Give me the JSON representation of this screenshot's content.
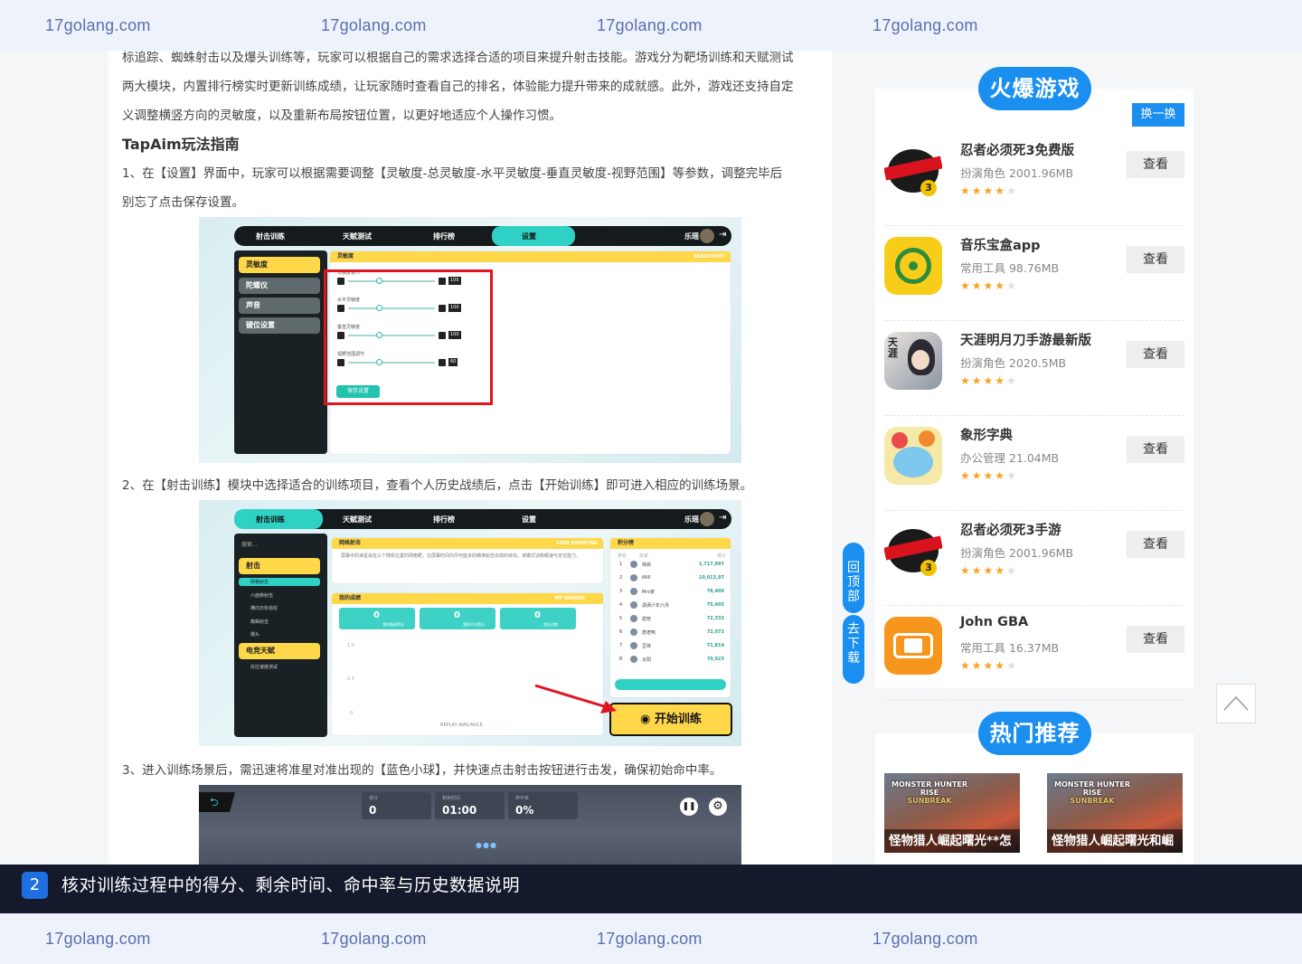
{
  "watermark": {
    "text": "17golang.com"
  },
  "article": {
    "intro_lines": [
      "标追踪、蜘蛛射击以及爆头训练等，玩家可以根据自己的需求选择合适的项目来提升射击技能。游戏分为靶场训练和天赋测试",
      "两大模块，内置排行榜实时更新训练成绩，让玩家随时查看自己的排名，体验能力提升带来的成就感。此外，游戏还支持自定",
      "义调整横竖方向的灵敏度，以及重新布局按钮位置，以更好地适应个人操作习惯。"
    ],
    "guide_title": "TapAim玩法指南",
    "step1_lines": [
      "1、在【设置】界面中，玩家可以根据需要调整【灵敏度-总灵敏度-水平灵敏度-垂直灵敏度-视野范围】等参数，调整完毕后",
      "别忘了点击保存设置。"
    ],
    "step2": "2、在【射击训练】模块中选择适合的训练项目，查看个人历史战绩后，点击【开始训练】即可进入相应的训练场景。",
    "step3": "3、进入训练场景后，需迅速将准星对准出现的【蓝色小球】，并快速点击射击按钮进行击发，确保初始命中率。"
  },
  "shot1": {
    "nav": [
      "射击训练",
      "天赋测试",
      "排行榜",
      "设置"
    ],
    "nav_user": "乐瑶",
    "side": [
      "灵敏度",
      "陀螺仪",
      "声音",
      "键位设置"
    ],
    "panel_title": "灵敏度",
    "panel_tag": "SENSITIVITY",
    "rows": [
      {
        "label": "灵敏度调节",
        "value": "100",
        "level": 0.35
      },
      {
        "label": "水平灵敏度",
        "value": "100",
        "level": 0.35
      },
      {
        "label": "垂直灵敏度",
        "value": "100",
        "level": 0.35
      },
      {
        "label": "视野范围调节",
        "value": "60",
        "level": 0.35
      }
    ],
    "save": "保存设置"
  },
  "shot2": {
    "nav": [
      "射击训练",
      "天赋测试",
      "排行榜",
      "设置"
    ],
    "nav_user": "乐瑶",
    "search": "搜索...",
    "group1": "射击",
    "sub1": [
      "网格射击",
      "六面移射击",
      "横向日标追纹",
      "蜘蛛射击",
      "爆头"
    ],
    "group2": "电竞天赋",
    "sub2": [
      "反应速度测试"
    ],
    "grid_title": "网格射击",
    "grid_tag": "GRID SHOOTING",
    "grid_desc": "屏幕中的准星会在三个随机位置的网格靶，在屏幕时间内尽可能多的精准射击出现的目标，该模式训练眼速与定位能力。",
    "grades_title": "我的成绩",
    "grades_tag": "MY GRADES",
    "grades": [
      {
        "value": "0",
        "label": "我的最高得分"
      },
      {
        "value": "0",
        "label": "我的平均得分"
      },
      {
        "value": "0",
        "label": "游玩次数"
      }
    ],
    "yticks": [
      "1.0",
      "0.5",
      "0"
    ],
    "replay": "REPLAY AVALAVILE",
    "rank_title": "积分榜",
    "rank_cols": [
      "排名",
      "玩家",
      "得分"
    ],
    "rank": [
      {
        "r": "1",
        "n": "林启",
        "s": "1,717,997"
      },
      {
        "r": "2",
        "n": "666",
        "s": "10,013,97"
      },
      {
        "r": "3",
        "n": "Mrz家",
        "s": "76,409"
      },
      {
        "r": "4",
        "n": "潇洒少年六月",
        "s": "75,405"
      },
      {
        "r": "5",
        "n": "碧管",
        "s": "72,333"
      },
      {
        "r": "6",
        "n": "唐老鸭",
        "s": "72,073"
      },
      {
        "r": "7",
        "n": "豆荷",
        "s": "71,814"
      },
      {
        "r": "8",
        "n": "太阳",
        "s": "70,923"
      }
    ],
    "start": "开始训练"
  },
  "shot3": {
    "hud": [
      {
        "label": "得分",
        "value": "0"
      },
      {
        "label": "剩余时间",
        "value": "01:00"
      },
      {
        "label": "命中率",
        "value": "0%"
      }
    ]
  },
  "sidebar": {
    "hot_title": "火爆游戏",
    "swap": "换一换",
    "view_label": "查看",
    "games": [
      {
        "name": "忍者必须死3免费版",
        "meta": "扮演角色 2001.96MB",
        "stars": 4,
        "icon": "ninja-icon"
      },
      {
        "name": "音乐宝盒app",
        "meta": "常用工具 98.76MB",
        "stars": 4,
        "icon": "music-box-icon"
      },
      {
        "name": "天涯明月刀手游最新版",
        "meta": "扮演角色 2020.5MB",
        "stars": 4,
        "icon": "swordswoman-icon"
      },
      {
        "name": "象形字典",
        "meta": "办公管理 21.04MB",
        "stars": 4,
        "icon": "elephant-icon"
      },
      {
        "name": "忍者必须死3手游",
        "meta": "扮演角色 2001.96MB",
        "stars": 4,
        "icon": "ninja-icon"
      },
      {
        "name": "John GBA",
        "meta": "常用工具 16.37MB",
        "stars": 4,
        "icon": "gamepad-icon"
      }
    ],
    "rec_title": "热门推荐",
    "rec": [
      {
        "caption": "怪物猎人崛起曙光**怎",
        "logo": "MONSTER HUNTER",
        "sub": "RISE",
        "sub2": "SUNBREAK"
      },
      {
        "caption": "怪物猎人崛起曙光和崛",
        "logo": "MONSTER HUNTER",
        "sub": "RISE",
        "sub2": "SUNBREAK"
      }
    ]
  },
  "float": {
    "top": "回顶部",
    "download": "去下载"
  },
  "task": {
    "number": "2",
    "text": "核对训练过程中的得分、剩余时间、命中率与历史数据说明"
  }
}
